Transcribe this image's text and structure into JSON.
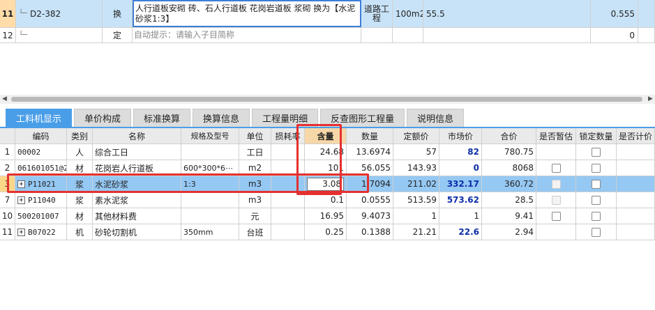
{
  "top_rows": [
    {
      "num": "11",
      "code": "D2-382",
      "type": "换",
      "name": "人行道板安砌 砖、石人行道板 花岗岩道板 浆砌  换为【水泥砂浆1:3】",
      "major": "道路工程",
      "unit": "100m2",
      "qty": "55.5",
      "value": "0.555"
    },
    {
      "num": "12",
      "code": "",
      "type": "定",
      "name": "自动提示：请输入子目简称",
      "major": "",
      "unit": "",
      "qty": "",
      "value": "0"
    }
  ],
  "tabs": [
    "工料机显示",
    "单价构成",
    "标准换算",
    "换算信息",
    "工程量明细",
    "反查图形工程量",
    "说明信息"
  ],
  "columns": {
    "num": "",
    "code": "编码",
    "type": "类别",
    "name": "名称",
    "spec": "规格及型号",
    "unit": "单位",
    "loss": "损耗率",
    "content": "含量",
    "qty": "数量",
    "quota_price": "定额价",
    "market_price": "市场价",
    "total": "合价",
    "is_estimate": "是否暂估",
    "lock_qty": "锁定数量",
    "is_calc": "是否计价"
  },
  "rows": [
    {
      "num": "1",
      "code": "00002",
      "type": "人",
      "name": "综合工日",
      "spec": "",
      "unit": "工日",
      "content": "24.68",
      "qty": "13.6974",
      "quota_price": "57",
      "market_price": "82",
      "total": "780.75"
    },
    {
      "num": "2",
      "code": "061601051@2",
      "type": "材",
      "name": "花岗岩人行道板",
      "spec": "600*300*6⋯",
      "unit": "m2",
      "content": "101",
      "qty": "56.055",
      "quota_price": "143.93",
      "market_price": "0",
      "total": "8068"
    },
    {
      "num": "3",
      "code": "P11021",
      "type": "浆",
      "name": "水泥砂浆",
      "spec": "1:3",
      "unit": "m3",
      "content": "3.08",
      "qty": "1.7094",
      "quota_price": "211.02",
      "market_price": "332.17",
      "total": "360.72"
    },
    {
      "num": "7",
      "code": "P11040",
      "type": "浆",
      "name": "素水泥浆",
      "spec": "",
      "unit": "m3",
      "content": "0.1",
      "qty": "0.0555",
      "quota_price": "513.59",
      "market_price": "573.62",
      "total": "28.5"
    },
    {
      "num": "10",
      "code": "500201007",
      "type": "材",
      "name": "其他材料费",
      "spec": "",
      "unit": "元",
      "content": "16.95",
      "qty": "9.4073",
      "quota_price": "1",
      "market_price": "1",
      "total": "9.41"
    },
    {
      "num": "11",
      "code": "B07022",
      "type": "机",
      "name": "砂轮切割机",
      "spec": "350mm",
      "unit": "台班",
      "content": "0.25",
      "qty": "0.1388",
      "quota_price": "21.21",
      "market_price": "22.6",
      "total": "2.94"
    }
  ]
}
